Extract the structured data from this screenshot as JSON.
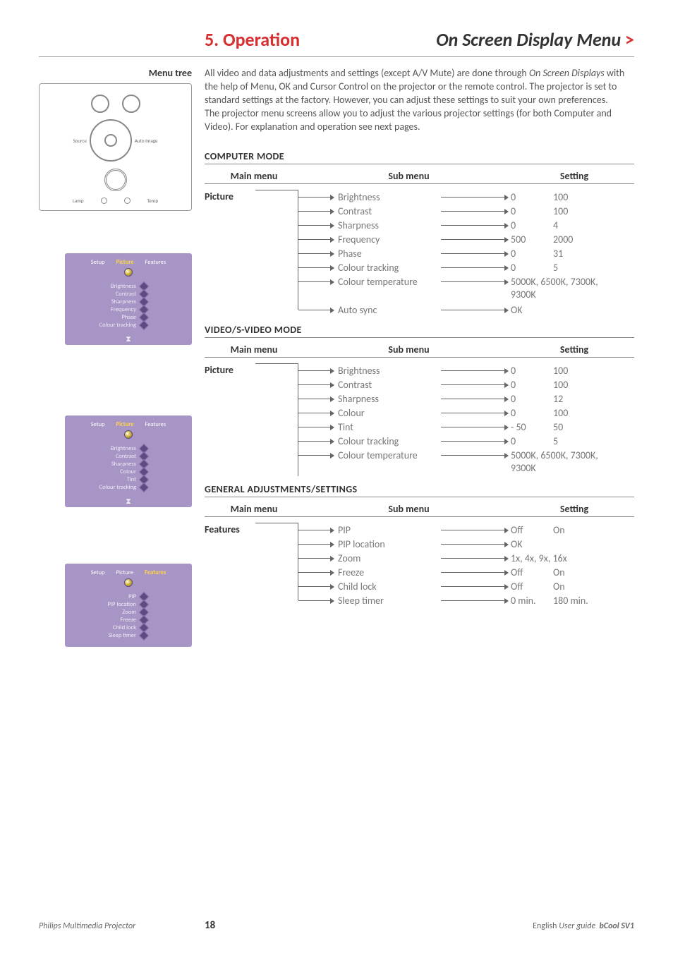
{
  "header": {
    "section_number": "5.",
    "section_title": "Operation",
    "page_title": "On Screen Display Menu",
    "chevron": ">"
  },
  "left": {
    "menu_tree": "Menu tree",
    "remote": {
      "source": "Source",
      "auto_image": "Auto Image",
      "ok": "",
      "lamp": "Lamp",
      "temp": "Temp"
    },
    "osd1": {
      "tabs": [
        "Setup",
        "Picture",
        "Features"
      ],
      "items": [
        "Brightness",
        "Contrast",
        "Sharpness",
        "Frequency",
        "Phase",
        "Colour tracking"
      ]
    },
    "osd2": {
      "tabs": [
        "Setup",
        "Picture",
        "Features"
      ],
      "items": [
        "Brightness",
        "Contrast",
        "Sharpness",
        "Colour",
        "Tint",
        "Colour tracking"
      ]
    },
    "osd3": {
      "tabs": [
        "Setup",
        "Picture",
        "Features"
      ],
      "items": [
        "PIP",
        "PIP location",
        "Zoom",
        "Freeze",
        "Child lock",
        "Sleep timer"
      ]
    }
  },
  "intro": {
    "p1a": "All video and data adjustments and settings (except A/V Mute) are done through ",
    "p1b": "On Screen Displays",
    "p1c": " with the help of Menu, OK and Cursor Control on the projector or the remote control. The projector is set to standard settings at the factory. However, you can adjust these settings to suit your own preferences.",
    "p2": "The projector menu screens allow you to adjust the various projector settings (for both Computer and Video). For explanation and operation see next pages."
  },
  "columns": {
    "main": "Main menu",
    "sub": "Sub menu",
    "setting": "Setting"
  },
  "sections": {
    "computer": {
      "title": "COMPUTER MODE",
      "main": "Picture",
      "rows": [
        {
          "sub": "Brightness",
          "a": "0",
          "b": "100"
        },
        {
          "sub": "Contrast",
          "a": "0",
          "b": "100"
        },
        {
          "sub": "Sharpness",
          "a": "0",
          "b": "4"
        },
        {
          "sub": "Frequency",
          "a": "500",
          "b": "2000"
        },
        {
          "sub": "Phase",
          "a": "0",
          "b": "31"
        },
        {
          "sub": "Colour tracking",
          "a": "0",
          "b": "5"
        },
        {
          "sub": "Colour temperature",
          "a": "5000K, 6500K, 7300K,",
          "b": ""
        },
        {
          "sub": "",
          "a": "9300K",
          "b": "",
          "extra": true
        },
        {
          "sub": "Auto sync",
          "a": "OK",
          "b": ""
        }
      ]
    },
    "video": {
      "title": "VIDEO/S-VIDEO MODE",
      "main": "Picture",
      "rows": [
        {
          "sub": "Brightness",
          "a": "0",
          "b": "100"
        },
        {
          "sub": "Contrast",
          "a": "0",
          "b": "100"
        },
        {
          "sub": "Sharpness",
          "a": "0",
          "b": "12"
        },
        {
          "sub": "Colour",
          "a": "0",
          "b": "100"
        },
        {
          "sub": "Tint",
          "a": "- 50",
          "b": "50"
        },
        {
          "sub": "Colour tracking",
          "a": "0",
          "b": "5"
        },
        {
          "sub": "Colour temperature",
          "a": "5000K, 6500K, 7300K,",
          "b": ""
        },
        {
          "sub": "",
          "a": "9300K",
          "b": "",
          "extra": true
        }
      ]
    },
    "general": {
      "title": "GENERAL ADJUSTMENTS/SETTINGS",
      "main": "Features",
      "rows": [
        {
          "sub": "PIP",
          "a": "Off",
          "b": "On"
        },
        {
          "sub": "PIP location",
          "a": "OK",
          "b": ""
        },
        {
          "sub": "Zoom",
          "a": "1x, 4x, 9x, 16x",
          "b": ""
        },
        {
          "sub": "Freeze",
          "a": "Off",
          "b": "On"
        },
        {
          "sub": "Child lock",
          "a": "Off",
          "b": "On"
        },
        {
          "sub": "Sleep timer",
          "a": "0 min.",
          "b": "180 min."
        }
      ]
    }
  },
  "footer": {
    "left": "Philips Multimedia Projector",
    "page": "18",
    "lang": "English",
    "guide": "User guide",
    "product": "bCool SV1"
  }
}
